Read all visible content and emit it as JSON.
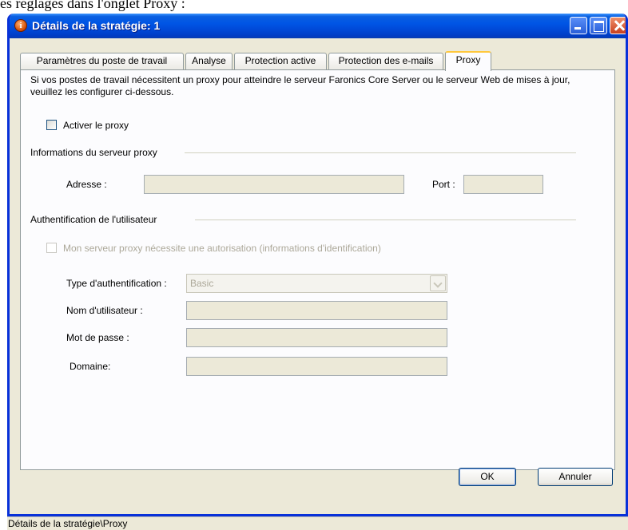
{
  "doc_fragment": "es réglages dans l'onglet Proxy :",
  "window": {
    "title": "Détails de la stratégie:  1",
    "title_icon_glyph": "i"
  },
  "tabs": [
    {
      "label": "Paramètres du poste de travail",
      "active": false
    },
    {
      "label": "Analyse",
      "active": false
    },
    {
      "label": "Protection active",
      "active": false
    },
    {
      "label": "Protection des e-mails",
      "active": false
    },
    {
      "label": "Proxy",
      "active": true
    }
  ],
  "proxy": {
    "description": "Si vos postes de travail nécessitent un proxy pour atteindre le serveur Faronics Core Server ou le serveur Web de mises à jour, veuillez les configurer ci-dessous.",
    "enable_label": "Activer le proxy",
    "enable_checked": false,
    "server_group_label": "Informations du serveur proxy",
    "address_label": "Adresse :",
    "address_value": "",
    "port_label": "Port :",
    "port_value": "",
    "auth_group_label": "Authentification de l'utilisateur",
    "auth_required_label": "Mon serveur proxy nécessite une autorisation (informations d'identification)",
    "auth_required_checked": false,
    "auth_type_label": "Type d'authentification :",
    "auth_type_value": "Basic",
    "username_label": "Nom d'utilisateur :",
    "username_value": "",
    "password_label": "Mot de passe :",
    "password_value": "",
    "domain_label": "Domaine:",
    "domain_value": ""
  },
  "buttons": {
    "ok": "OK",
    "cancel": "Annuler"
  },
  "statusbar": {
    "path": "Détails de la stratégie\\Proxy"
  },
  "colors": {
    "titlebar": "#0055e5",
    "window_bg": "#ece9d8",
    "active_tab_accent": "#ffc83c"
  }
}
